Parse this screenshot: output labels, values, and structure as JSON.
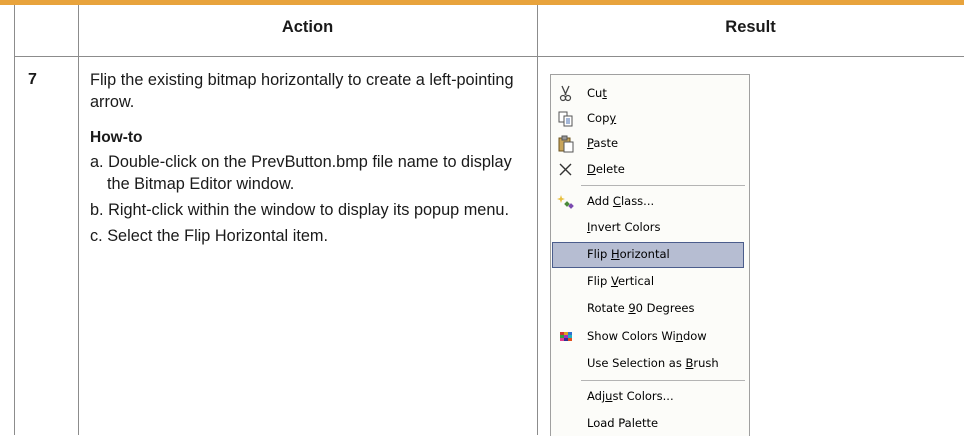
{
  "table": {
    "header_action": "Action",
    "header_result": "Result",
    "step_number": "7",
    "intro": "Flip the existing bitmap horizontally to create a left-pointing arrow.",
    "howto_title": "How-to",
    "steps": [
      "a. Double-click on the PrevButton.bmp file name to display the Bitmap Editor window.",
      "b. Right-click within the window to display its popup menu.",
      "c. Select the Flip Horizontal item."
    ]
  },
  "menu": {
    "items": [
      {
        "pre": "Cu",
        "u": "t",
        "post": "",
        "icon": "scissors-icon"
      },
      {
        "pre": "Cop",
        "u": "y",
        "post": "",
        "icon": "copy-icon"
      },
      {
        "pre": "",
        "u": "P",
        "post": "aste",
        "icon": "paste-icon"
      },
      {
        "pre": "",
        "u": "D",
        "post": "elete",
        "icon": "delete-icon"
      },
      {
        "pre": "Add ",
        "u": "C",
        "post": "lass...",
        "icon": "add-class-icon"
      },
      {
        "pre": "",
        "u": "I",
        "post": "nvert Colors",
        "icon": ""
      },
      {
        "pre": "Flip ",
        "u": "H",
        "post": "orizontal",
        "icon": "",
        "selected": true
      },
      {
        "pre": "Flip ",
        "u": "V",
        "post": "ertical",
        "icon": ""
      },
      {
        "pre": "Rotate ",
        "u": "9",
        "post": "0 Degrees",
        "icon": ""
      },
      {
        "pre": "Show Colors Wi",
        "u": "n",
        "post": "dow",
        "icon": "palette-icon"
      },
      {
        "pre": "Use Selection as ",
        "u": "B",
        "post": "rush",
        "icon": ""
      },
      {
        "pre": "Adj",
        "u": "u",
        "post": "st Colors...",
        "icon": ""
      },
      {
        "pre": "Load Palette",
        "u": "",
        "post": "",
        "icon": ""
      }
    ],
    "colors": {
      "selected_bg": "#b6bdd2",
      "selected_border": "#4b5d8c"
    }
  }
}
